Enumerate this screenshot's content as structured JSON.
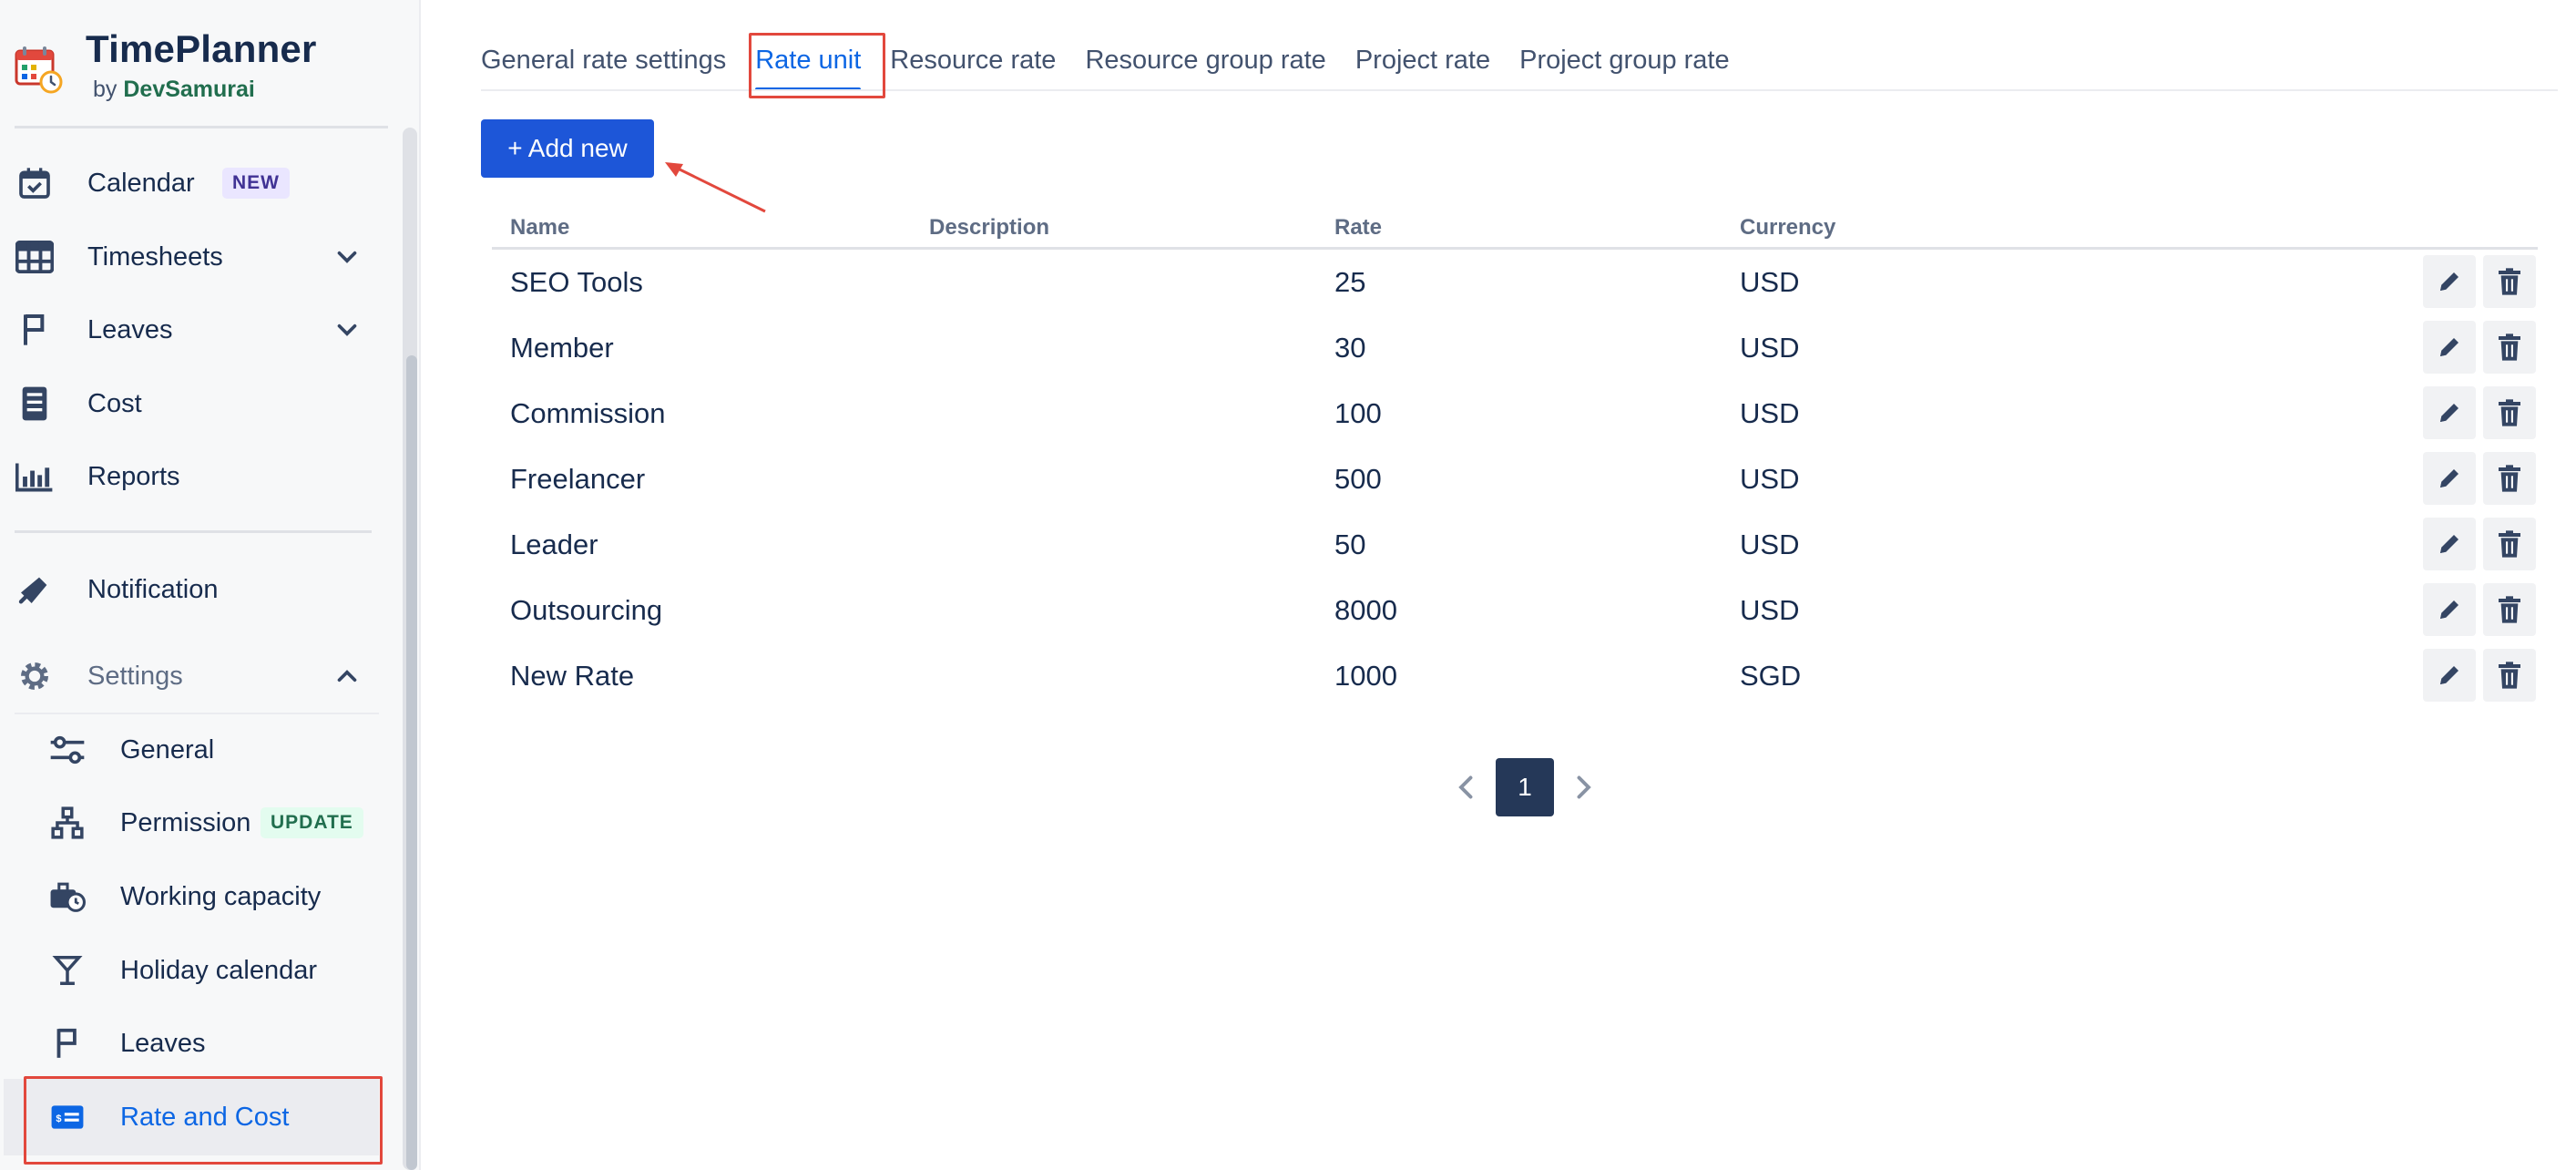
{
  "app": {
    "title": "TimePlanner",
    "by_prefix": "by",
    "brand": "DevSamurai"
  },
  "sidebar": {
    "items": [
      {
        "label": "Calendar",
        "icon": "calendar-check-icon",
        "badge": "NEW"
      },
      {
        "label": "Timesheets",
        "icon": "grid-table-icon",
        "chevron": "down"
      },
      {
        "label": "Leaves",
        "icon": "flag-icon",
        "chevron": "down"
      },
      {
        "label": "Cost",
        "icon": "receipt-icon"
      },
      {
        "label": "Reports",
        "icon": "bar-chart-icon"
      }
    ],
    "notification": {
      "label": "Notification",
      "icon": "megaphone-icon"
    },
    "settings": {
      "label": "Settings",
      "icon": "gear-icon",
      "chevron": "up",
      "items": [
        {
          "label": "General",
          "icon": "sliders-icon"
        },
        {
          "label": "Permission",
          "icon": "hierarchy-icon",
          "badge": "UPDATE"
        },
        {
          "label": "Working capacity",
          "icon": "briefcase-clock-icon"
        },
        {
          "label": "Holiday calendar",
          "icon": "cocktail-glass-icon"
        },
        {
          "label": "Leaves",
          "icon": "flag-icon"
        },
        {
          "label": "Rate and Cost",
          "icon": "money-card-icon",
          "active": true
        }
      ]
    }
  },
  "tabs": [
    {
      "label": "General rate settings"
    },
    {
      "label": "Rate unit",
      "active": true
    },
    {
      "label": "Resource rate"
    },
    {
      "label": "Resource group rate"
    },
    {
      "label": "Project rate"
    },
    {
      "label": "Project group rate"
    }
  ],
  "add_button": {
    "label": "+ Add new"
  },
  "table": {
    "headers": {
      "name": "Name",
      "description": "Description",
      "rate": "Rate",
      "currency": "Currency"
    },
    "rows": [
      {
        "name": "SEO Tools",
        "description": "",
        "rate": "25",
        "currency": "USD"
      },
      {
        "name": "Member",
        "description": "",
        "rate": "30",
        "currency": "USD"
      },
      {
        "name": "Commission",
        "description": "",
        "rate": "100",
        "currency": "USD"
      },
      {
        "name": "Freelancer",
        "description": "",
        "rate": "500",
        "currency": "USD"
      },
      {
        "name": "Leader",
        "description": "",
        "rate": "50",
        "currency": "USD"
      },
      {
        "name": "Outsourcing",
        "description": "",
        "rate": "8000",
        "currency": "USD"
      },
      {
        "name": "New Rate",
        "description": "",
        "rate": "1000",
        "currency": "SGD"
      }
    ]
  },
  "pagination": {
    "current_page": "1"
  },
  "colors": {
    "primary": "#1d56d8",
    "active_text": "#0c66e4",
    "annotation": "#e2483d",
    "page_active": "#253858"
  }
}
